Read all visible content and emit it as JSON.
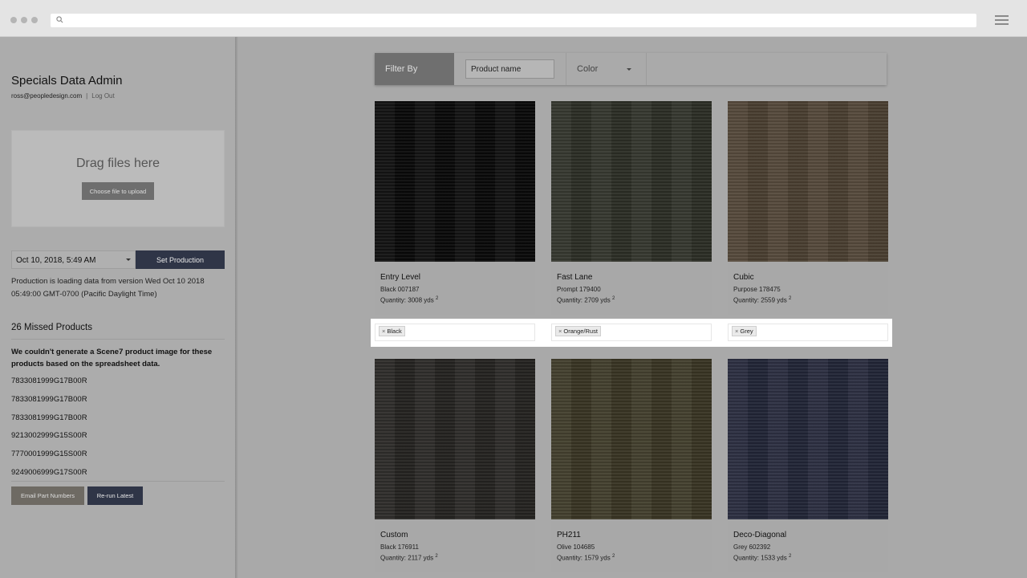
{
  "sidebar": {
    "title": "Specials Data Admin",
    "email": "ross@peopledesign.com",
    "separator": "|",
    "logout_label": "Log Out",
    "dropzone": {
      "title": "Drag files here",
      "button_label": "Choose file to upload"
    },
    "date_value": "Oct 10, 2018, 5:49 AM",
    "set_production_label": "Set Production",
    "production_note": "Production is loading data from version Wed Oct 10 2018 05:49:00 GMT-0700 (Pacific Daylight Time)",
    "missed_title": "26 Missed Products",
    "missed_desc": "We couldn't generate a Scene7 product image for these products based on the spreadsheet data.",
    "part_numbers": [
      "7833081999G17B00R",
      "7833081999G17B00R",
      "7833081999G17B00R",
      "9213002999G15S00R",
      "7770001999G15S00R",
      "9249006999G17S00R"
    ],
    "email_button_label": "Email Part Numbers",
    "rerun_button_label": "Re-run Latest"
  },
  "filter": {
    "label": "Filter By",
    "name_placeholder": "Product name",
    "color_label": "Color"
  },
  "products": [
    {
      "name": "Entry Level",
      "code": "Black 007187",
      "qty": "Quantity: 3008 yds",
      "qty_sup": "2",
      "tag": "Black",
      "swatch": "#0a0a0a"
    },
    {
      "name": "Fast Lane",
      "code": "Prompt 179400",
      "qty": "Quantity: 2709 yds",
      "qty_sup": "2",
      "tag": "Orange/Rust",
      "swatch": "#2e3028"
    },
    {
      "name": "Cubic",
      "code": "Purpose 178475",
      "qty": "Quantity: 2559 yds",
      "qty_sup": "2",
      "tag": "Grey",
      "swatch": "#4f4334"
    },
    {
      "name": "Custom",
      "code": "Black 176911",
      "qty": "Quantity: 2117 yds",
      "qty_sup": "2",
      "swatch": "#272522"
    },
    {
      "name": "PH211",
      "code": "Olive 104685",
      "qty": "Quantity: 1579 yds",
      "qty_sup": "2",
      "swatch": "#3c3826"
    },
    {
      "name": "Deco-Diagonal",
      "code": "Grey 602392",
      "qty": "Quantity: 1533 yds",
      "qty_sup": "2",
      "swatch": "#24283a"
    }
  ],
  "tag_remove_glyph": "×"
}
